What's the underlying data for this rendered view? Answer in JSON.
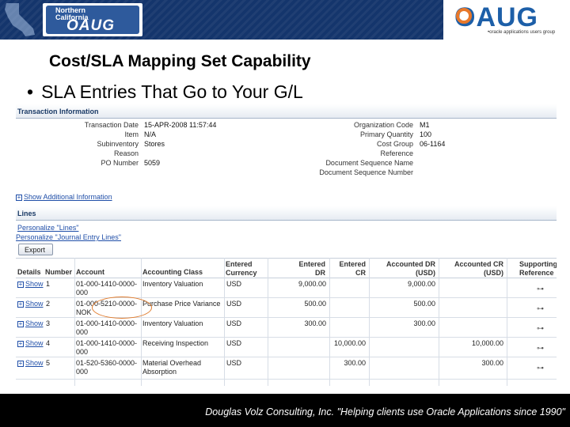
{
  "header": {
    "logo_left_line1": "Northern",
    "logo_left_line2": "California",
    "logo_left_line3": "OAUG",
    "logo_right_name": "OAUG",
    "logo_right_tagline": "oracle applications users group"
  },
  "slide": {
    "title": "Cost/SLA Mapping Set Capability",
    "bullet": "SLA Entries That Go to Your G/L"
  },
  "transaction_info": {
    "heading": "Transaction Information",
    "left_fields": [
      {
        "label": "Transaction Date",
        "value": "15-APR-2008 11:57:44"
      },
      {
        "label": "Item",
        "value": "N/A"
      },
      {
        "label": "Subinventory",
        "value": "Stores"
      },
      {
        "label": "Reason",
        "value": ""
      },
      {
        "label": "PO Number",
        "value": "5059"
      }
    ],
    "right_fields": [
      {
        "label": "Organization Code",
        "value": "M1"
      },
      {
        "label": "Primary Quantity",
        "value": "100"
      },
      {
        "label": "Cost Group",
        "value": "06-1164"
      },
      {
        "label": "Reference",
        "value": ""
      },
      {
        "label": "Document Sequence Name",
        "value": ""
      },
      {
        "label": "Document Sequence Number",
        "value": ""
      }
    ],
    "show_additional_link": "Show Additional Information"
  },
  "lines": {
    "heading": "Lines",
    "personalize_lines_link": "Personalize \"Lines\"",
    "personalize_journal_link": "Personalize \"Journal Entry Lines\"",
    "export_label": "Export",
    "columns": {
      "details": "Details",
      "number": "Number",
      "account": "Account",
      "accounting_class": "Accounting Class",
      "entered_currency": "Entered Currency",
      "entered_dr": "Entered DR",
      "entered_cr": "Entered CR",
      "accounted_dr": "Accounted DR (USD)",
      "accounted_cr": "Accounted CR (USD)",
      "supporting_reference": "Supporting Reference"
    },
    "rows": [
      {
        "details": "Show",
        "number": "1",
        "account": "01-000-1410-0000-000",
        "accounting_class": "Inventory Valuation",
        "currency": "USD",
        "entered_dr": "9,000.00",
        "entered_cr": "",
        "accounted_dr": "9,000.00",
        "accounted_cr": ""
      },
      {
        "details": "Show",
        "number": "2",
        "account": "01-000-5210-0000-NOK",
        "accounting_class": "Purchase Price Variance",
        "currency": "USD",
        "entered_dr": "500.00",
        "entered_cr": "",
        "accounted_dr": "500.00",
        "accounted_cr": ""
      },
      {
        "details": "Show",
        "number": "3",
        "account": "01-000-1410-0000-000",
        "accounting_class": "Inventory Valuation",
        "currency": "USD",
        "entered_dr": "300.00",
        "entered_cr": "",
        "accounted_dr": "300.00",
        "accounted_cr": ""
      },
      {
        "details": "Show",
        "number": "4",
        "account": "01-000-1410-0000-000",
        "accounting_class": "Receiving Inspection",
        "currency": "USD",
        "entered_dr": "",
        "entered_cr": "10,000.00",
        "accounted_dr": "",
        "accounted_cr": "10,000.00"
      },
      {
        "details": "Show",
        "number": "5",
        "account": "01-520-5360-0000-000",
        "accounting_class": "Material Overhead Absorption",
        "currency": "USD",
        "entered_dr": "",
        "entered_cr": "300.00",
        "accounted_dr": "",
        "accounted_cr": "300.00"
      }
    ]
  },
  "footer": {
    "text": "Douglas Volz Consulting, Inc. \"Helping clients use Oracle Applications since 1990\""
  },
  "colors": {
    "banner": "#14356c",
    "highlight": "#e07b2c",
    "link": "#1f4ea8",
    "oaug_blue": "#1d5fa8"
  }
}
